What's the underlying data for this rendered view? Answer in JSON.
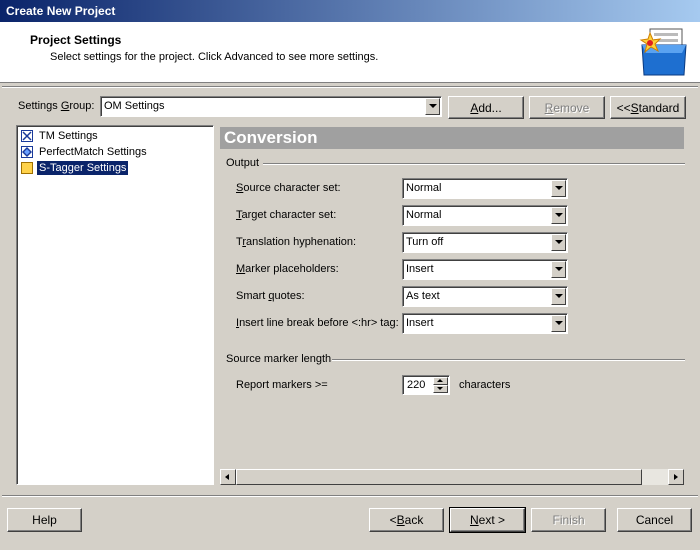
{
  "window": {
    "title": "Create New Project"
  },
  "header": {
    "title": "Project Settings",
    "subtitle": "Select settings for the project. Click Advanced to see more settings."
  },
  "settings_group": {
    "label_pre": "Settings ",
    "label_key": "G",
    "label_post": "roup:",
    "value": "OM Settings"
  },
  "top_buttons": {
    "add": {
      "key": "A",
      "rest": "dd..."
    },
    "remove": {
      "key": "R",
      "rest": "emove"
    },
    "standard": {
      "pre": "<< ",
      "key": "S",
      "rest": "tandard"
    }
  },
  "tree": {
    "items": [
      {
        "label": "TM Settings",
        "icon": "tm-settings-icon",
        "selected": false
      },
      {
        "label": "PerfectMatch Settings",
        "icon": "perfectmatch-icon",
        "selected": false
      },
      {
        "label": "S-Tagger Settings",
        "icon": "s-tagger-icon",
        "selected": true
      }
    ]
  },
  "panel": {
    "title": "Conversion",
    "output_group": "Output",
    "fields": [
      {
        "key": "S",
        "rest": "ource character set:",
        "value": "Normal"
      },
      {
        "key": "T",
        "rest": "arget character set:",
        "value": "Normal"
      },
      {
        "pre": "T",
        "key": "r",
        "rest": "anslation hyphenation:",
        "value": "Turn off"
      },
      {
        "key": "M",
        "rest": "arker placeholders:",
        "value": "Insert"
      },
      {
        "pre": "Smart ",
        "key": "q",
        "rest": "uotes:",
        "value": "As text"
      },
      {
        "key": "I",
        "rest": "nsert line break before <:hr> tag:",
        "value": "Insert"
      }
    ],
    "marker_group": "Source marker length",
    "report_label": "Report markers >=",
    "report_value": "220",
    "report_unit": "characters"
  },
  "bottom_buttons": {
    "help": "Help",
    "back": {
      "pre": "< ",
      "key": "B",
      "rest": "ack"
    },
    "next": {
      "key": "N",
      "rest": "ext >"
    },
    "finish": "Finish",
    "cancel": "Cancel"
  },
  "colors": {
    "titlebar_start": "#0a246a",
    "titlebar_end": "#a6caf0",
    "selection": "#0a246a",
    "panel_header": "#a0a0a0"
  }
}
